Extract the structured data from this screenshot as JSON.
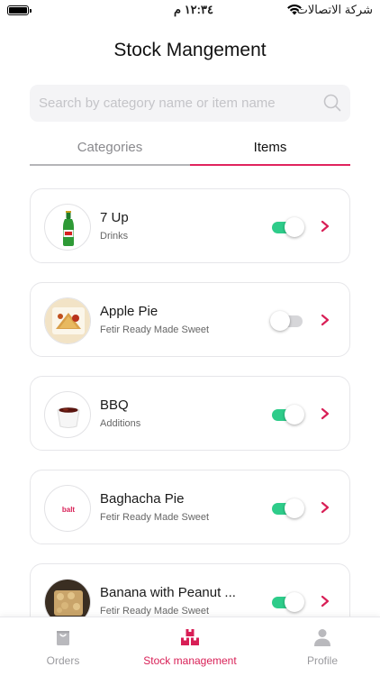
{
  "status_bar": {
    "time": "١٢:٣٤ م",
    "carrier": "شركة الاتصالات"
  },
  "header": {
    "title": "Stock Mangement"
  },
  "search": {
    "placeholder": "Search by category name or item name",
    "value": ""
  },
  "tabs": [
    {
      "label": "Categories",
      "active": false
    },
    {
      "label": "Items",
      "active": true
    }
  ],
  "items": [
    {
      "name": "7 Up",
      "category": "Drinks",
      "available": true
    },
    {
      "name": "Apple Pie",
      "category": "Fetir Ready Made Sweet",
      "available": false
    },
    {
      "name": "BBQ",
      "category": "Additions",
      "available": true
    },
    {
      "name": "Baghacha Pie",
      "category": "Fetir Ready Made Sweet",
      "available": true,
      "logo_text": "balt"
    },
    {
      "name": "Banana with Peanut ...",
      "category": "Fetir Ready Made Sweet",
      "available": true
    }
  ],
  "bottom_nav": [
    {
      "label": "Orders",
      "icon": "bag-icon",
      "active": false
    },
    {
      "label": "Stock management",
      "icon": "boxes-icon",
      "active": true
    },
    {
      "label": "Profile",
      "icon": "person-icon",
      "active": false
    }
  ],
  "colors": {
    "accent": "#e0245e",
    "toggle_on": "#2ecc8a",
    "toggle_off": "#d6d6d9",
    "nav_active": "#d81f56",
    "nav_inactive": "#9a9a9e"
  }
}
